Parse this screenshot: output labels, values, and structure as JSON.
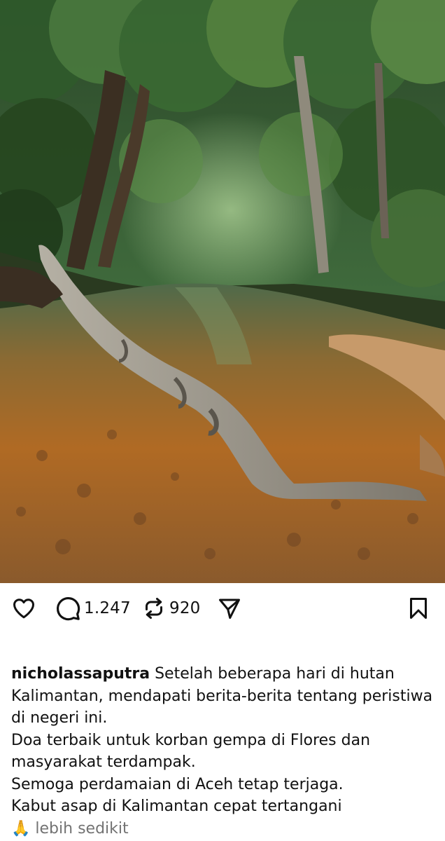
{
  "post": {
    "image_alt": "forest river with fallen log",
    "actions": {
      "like_icon": "heart-icon",
      "comment_icon": "comment-icon",
      "comment_count": "1.247",
      "repost_icon": "repost-icon",
      "repost_count": "920",
      "share_icon": "send-icon",
      "save_icon": "bookmark-icon"
    },
    "caption": {
      "username": "nicholassaputra",
      "line1": " Setelah beberapa hari di hutan",
      "line2": "Kalimantan, mendapati berita-berita tentang peristiwa",
      "line3": "di negeri ini.",
      "line4": "Doa terbaik untuk korban gempa di Flores dan",
      "line5": "masyarakat terdampak.",
      "line6": "Semoga perdamaian di Aceh tetap terjaga.",
      "line7": "Kabut asap di Kalimantan cepat tertangani",
      "emoji": "🙏",
      "less_link": "lebih sedikit"
    }
  }
}
